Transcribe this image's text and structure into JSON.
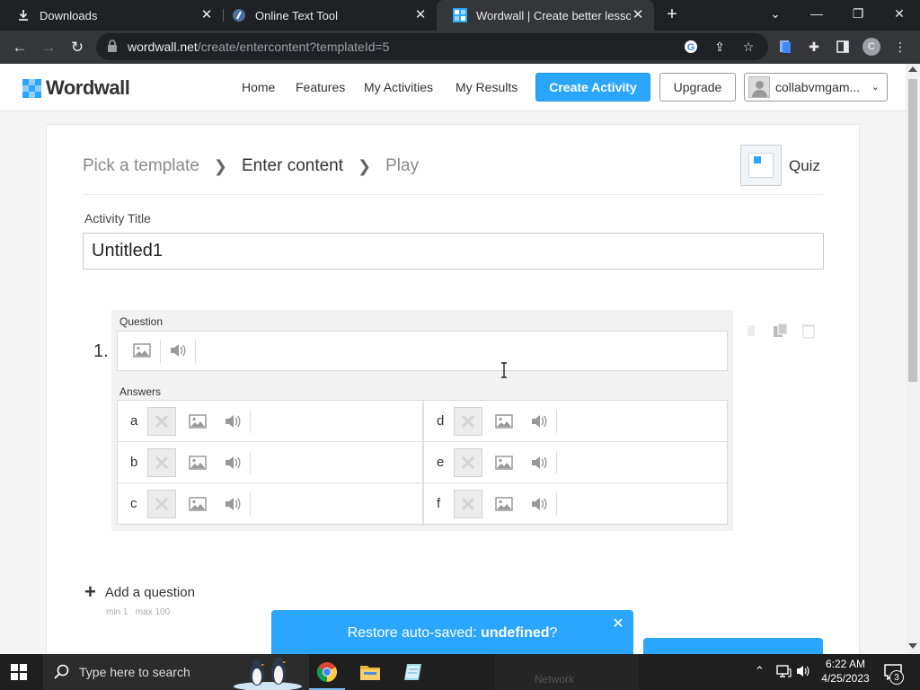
{
  "browser": {
    "tabs": [
      {
        "title": "Downloads",
        "icon": "download-icon"
      },
      {
        "title": "Online Text Tool",
        "icon": "text-tool-icon"
      },
      {
        "title": "Wordwall | Create better lessons",
        "icon": "wordwall-favicon"
      }
    ],
    "url_host": "wordwall.net",
    "url_path": "/create/entercontent?templateId=5",
    "profile_initial": "C"
  },
  "site": {
    "brand": "Wordwall",
    "nav": [
      "Home",
      "Features",
      "My Activities",
      "My Results"
    ],
    "create_label": "Create Activity",
    "upgrade_label": "Upgrade",
    "username": "collabvmgam...",
    "brand_color": "#2ba6ff"
  },
  "editor": {
    "breadcrumb": [
      "Pick a template",
      "Enter content",
      "Play"
    ],
    "template_name": "Quiz",
    "activity_title_label": "Activity Title",
    "activity_title_value": "Untitled1",
    "question_number": "1.",
    "question_label": "Question",
    "answers_label": "Answers",
    "answers": [
      "a",
      "b",
      "c",
      "d",
      "e",
      "f"
    ],
    "add_question_label": "Add a question",
    "min_label": "min 1",
    "max_label": "max 100"
  },
  "toast": {
    "prefix": "Restore auto-saved: ",
    "value": "undefined",
    "suffix": "?"
  },
  "taskbar": {
    "search_placeholder": "Type here to search",
    "ghost_label": "Network",
    "time": "6:22 AM",
    "date": "4/25/2023",
    "notification_count": "3"
  }
}
